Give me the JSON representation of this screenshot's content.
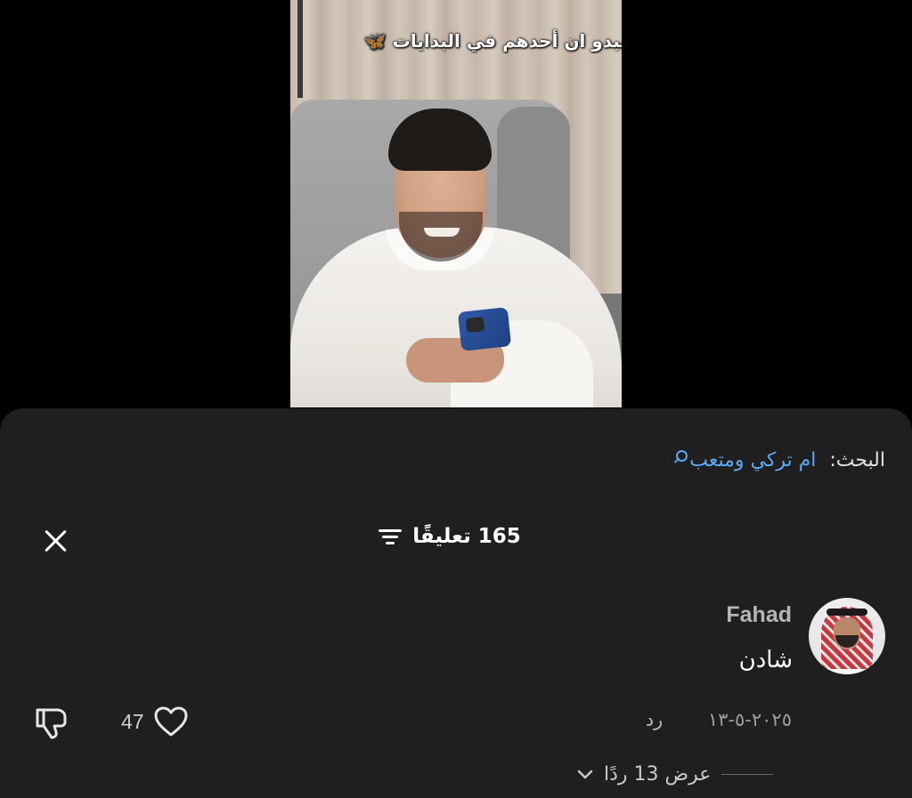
{
  "video": {
    "caption": "يبدو ان أحدهم في البدايات",
    "caption_emoji": "🦋"
  },
  "search": {
    "label": "البحث:",
    "query": "ام تركي ومتعب"
  },
  "comments_header": {
    "count": "165",
    "label": "تعليقًا"
  },
  "comment": {
    "username": "Fahad",
    "text": "شادن",
    "date": "٢٠٢٥-٥-١٣",
    "reply_label": "رد",
    "like_count": "47",
    "view_replies_label": "عرض 13 ردًا"
  },
  "colors": {
    "sheet_background": "#1f1f1f",
    "search_accent": "#5aa9f2",
    "text_primary": "#ffffff",
    "text_secondary": "#9e9e9e"
  },
  "icons": [
    "close-icon",
    "filter-icon",
    "search-icon",
    "heart-icon",
    "dislike-icon",
    "chevron-down-icon"
  ]
}
